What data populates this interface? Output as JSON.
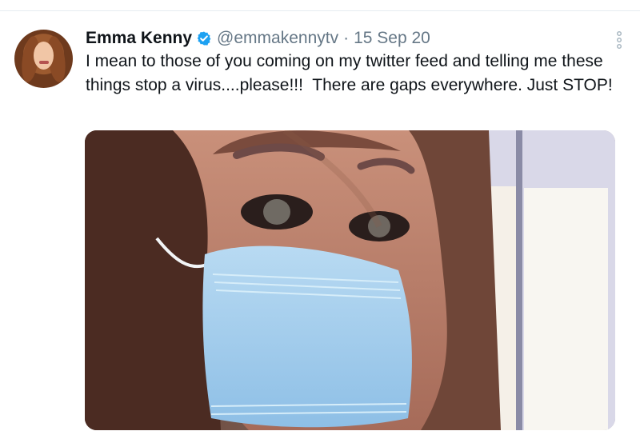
{
  "tweet": {
    "author": {
      "display_name": "Emma Kenny",
      "handle": "@emmakennytv",
      "verified_icon": "verified-badge-icon"
    },
    "timestamp": "15 Sep 20",
    "text": "I mean to those of you coming on my twitter feed and telling me these things stop a virus....please!!!  There are gaps everywhere. Just STOP!",
    "media": {
      "type": "photo",
      "subject": "selfie wearing a blue surgical mask"
    },
    "menu_icon": "vertical-dots-icon"
  },
  "colors": {
    "text": "#0f1419",
    "secondary": "#657786",
    "verified": "#1da1f2",
    "mask": "#9bc9ec"
  }
}
